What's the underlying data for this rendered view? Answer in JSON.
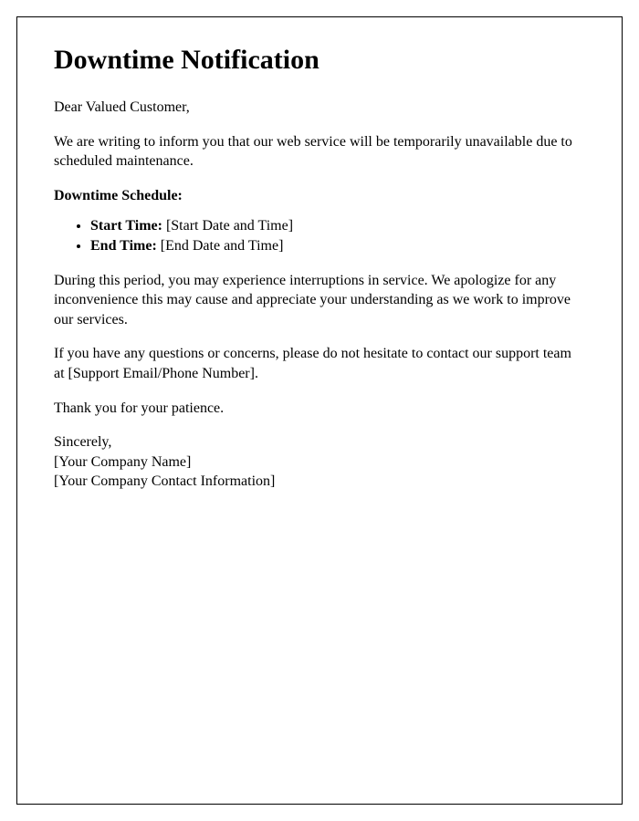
{
  "title": "Downtime Notification",
  "salutation": "Dear Valued Customer,",
  "intro": "We are writing to inform you that our web service will be temporarily unavailable due to scheduled maintenance.",
  "schedule_label": "Downtime Schedule:",
  "schedule": {
    "start_label": "Start Time:",
    "start_value": " [Start Date and Time]",
    "end_label": "End Time:",
    "end_value": " [End Date and Time]"
  },
  "body1": "During this period, you may experience interruptions in service. We apologize for any inconvenience this may cause and appreciate your understanding as we work to improve our services.",
  "body2": "If you have any questions or concerns, please do not hesitate to contact our support team at [Support Email/Phone Number].",
  "thanks": "Thank you for your patience.",
  "closing": {
    "signoff": "Sincerely,",
    "company": "[Your Company Name]",
    "contact": "[Your Company Contact Information]"
  }
}
